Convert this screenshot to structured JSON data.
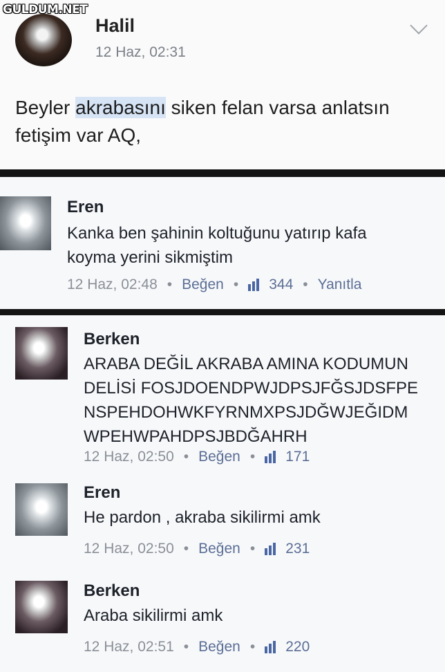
{
  "watermark": "GULDUM.NET",
  "post": {
    "author": "Halil",
    "time": "12 Haz, 02:31",
    "text_before": "Beyler ",
    "text_highlight": "akrabasını",
    "text_after": " siken felan varsa anlatsın fetişim var AQ,"
  },
  "comments": [
    {
      "name": "Eren",
      "text": "Kanka ben şahinin koltuğunu yatırıp kafa koyma yerini sikmiştim",
      "time": "12 Haz, 02:48",
      "like_label": "Beğen",
      "likes": "344",
      "reply_label": "Yanıtla"
    },
    {
      "name": "Berken",
      "text": "ARABA DEĞİL AKRABA AMINA KODUMUN DELİSİ FOSJDOENDPWJDPSJFĞSJDSFPE NSPEHDOHWKFYRNMXPSJDĞWJEĞIDM WPEHWPAHDPSJBDĞAHRH",
      "time": "12 Haz, 02:50",
      "like_label": "Beğen",
      "likes": "171"
    },
    {
      "name": "Eren",
      "text": "He pardon , akraba sikilirmi amk",
      "time": "12 Haz, 02:50",
      "like_label": "Beğen",
      "likes": "231"
    },
    {
      "name": "Berken",
      "text": "Araba sikilirmi amk",
      "time": "12 Haz, 02:51",
      "like_label": "Beğen",
      "likes": "220"
    }
  ],
  "icons": {
    "post_menu": "chevron-down-icon",
    "like": "thumbs-up-icon"
  }
}
